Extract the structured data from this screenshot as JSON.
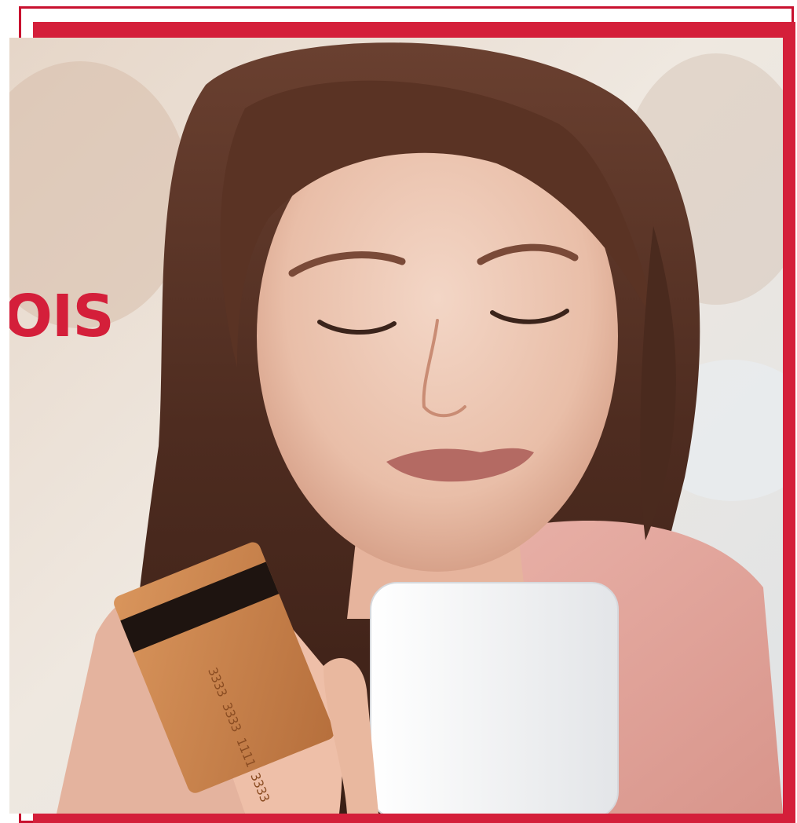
{
  "headline": {
    "text": "OIS"
  },
  "colors": {
    "accent": "#d41f3a",
    "frame": "#c8102e",
    "card": "#c98650",
    "phone": "#f2f2f2",
    "top": "#e5a8a0"
  },
  "scene": {
    "subject": "woman",
    "objects": [
      "credit-card",
      "smartphone"
    ]
  }
}
